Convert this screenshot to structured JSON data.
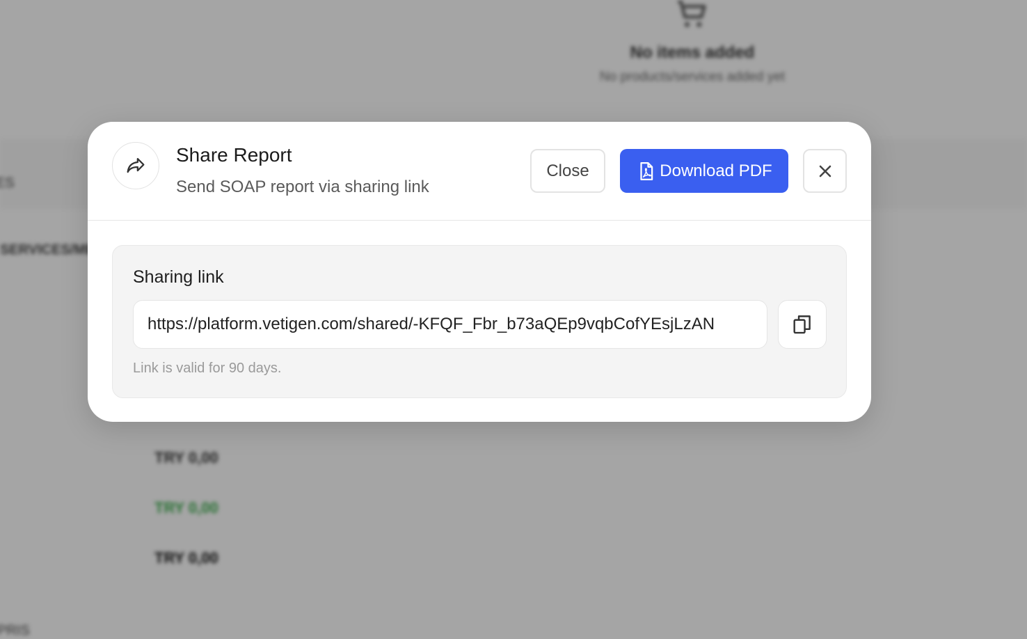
{
  "background": {
    "empty_title": "No items added",
    "empty_subtitle": "No products/services added yet",
    "fragments": [
      "ES",
      "SERVICES/MEDS",
      "PRIS"
    ],
    "prices": {
      "row1": "TRY 0,00",
      "row2": "TRY 0,00",
      "row3": "TRY 0,00"
    },
    "icons": {
      "empty_state": "shopping-cart-icon"
    }
  },
  "modal": {
    "title": "Share Report",
    "subtitle": "Send SOAP report via sharing link",
    "buttons": {
      "close_label": "Close",
      "download_label": "Download PDF"
    },
    "icons": {
      "header": "share-forward-icon",
      "download": "pdf-file-icon",
      "dismiss": "close-x-icon",
      "copy": "copy-icon"
    },
    "sharing": {
      "label": "Sharing link",
      "url": "https://platform.vetigen.com/shared/-KFQF_Fbr_b73aQEp9vqbCofYEsjLzAN",
      "validity_note": "Link is valid for 90 days."
    }
  },
  "colors": {
    "primary": "#3a5ff0",
    "overlay": "rgba(0,0,0,0.32)",
    "positive_price": "#3aa64a"
  }
}
